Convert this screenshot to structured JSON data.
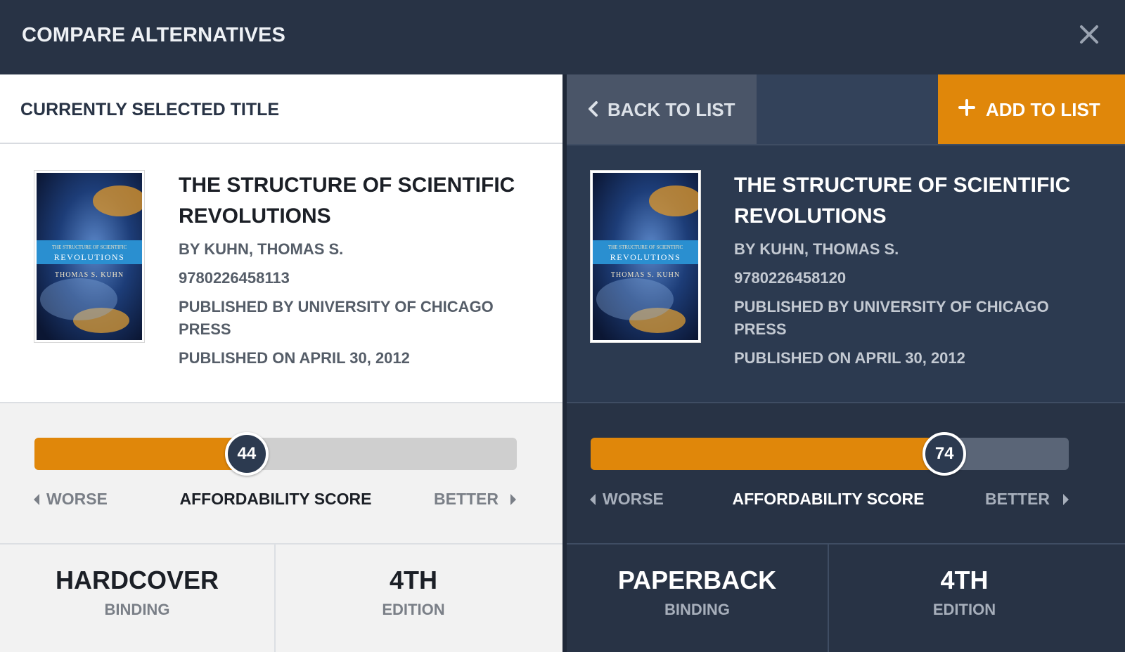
{
  "header": {
    "title": "COMPARE ALTERNATIVES",
    "close_icon": "close-icon"
  },
  "left": {
    "section_label": "CURRENTLY SELECTED TITLE",
    "book": {
      "title_line1": "THE STRUCTURE OF SCIENTIFIC",
      "title_line2": "REVOLUTIONS",
      "author": "BY KUHN, THOMAS S.",
      "isbn": "9780226458113",
      "publisher_line1": "PUBLISHED BY UNIVERSITY OF CHICAGO",
      "publisher_line2": "PRESS",
      "published_on": "PUBLISHED ON APRIL 30, 2012"
    },
    "score": {
      "value": "44",
      "fraction": 0.44,
      "worse": "WORSE",
      "label": "AFFORDABILITY SCORE",
      "better": "BETTER"
    },
    "binding": {
      "value": "HARDCOVER",
      "label": "BINDING"
    },
    "edition": {
      "value": "4TH",
      "label": "EDITION"
    }
  },
  "right": {
    "back_label": "BACK TO LIST",
    "add_label": "ADD TO LIST",
    "book": {
      "title_line1": "THE STRUCTURE OF SCIENTIFIC",
      "title_line2": "REVOLUTIONS",
      "author": "BY KUHN, THOMAS S.",
      "isbn": "9780226458120",
      "publisher_line1": "PUBLISHED BY UNIVERSITY OF CHICAGO",
      "publisher_line2": "PRESS",
      "published_on": "PUBLISHED ON APRIL 30, 2012"
    },
    "score": {
      "value": "74",
      "fraction": 0.74,
      "worse": "WORSE",
      "label": "AFFORDABILITY SCORE",
      "better": "BETTER"
    },
    "binding": {
      "value": "PAPERBACK",
      "label": "BINDING"
    },
    "edition": {
      "value": "4TH",
      "label": "EDITION"
    }
  },
  "cover": {
    "line1": "THE STRUCTURE OF SCIENTIFIC",
    "line2": "REVOLUTIONS",
    "line3": "THOMAS S. KUHN"
  },
  "colors": {
    "header_bg": "#283345",
    "accent_orange": "#e0870a",
    "right_panel_bg": "#2c3a50",
    "left_panel_bg": "#ffffff"
  }
}
